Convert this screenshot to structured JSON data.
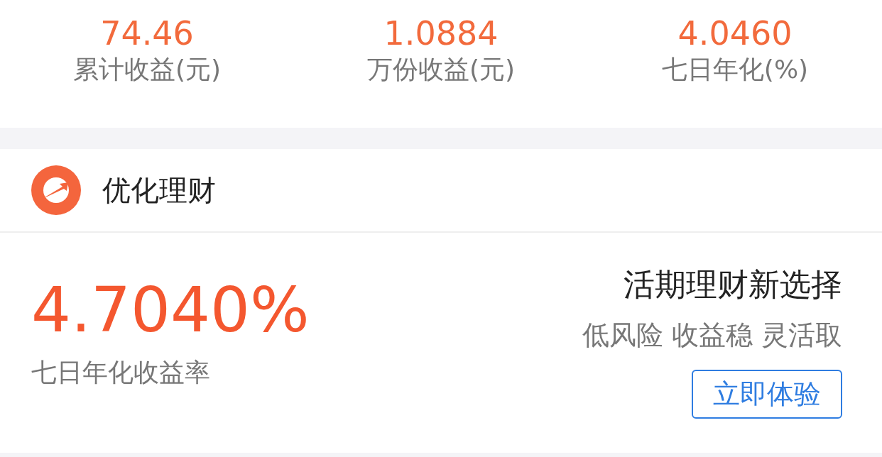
{
  "stats": [
    {
      "value": "74.46",
      "label": "累计收益(元)"
    },
    {
      "value": "1.0884",
      "label": "万份收益(元)"
    },
    {
      "value": "4.0460",
      "label": "七日年化(%)"
    }
  ],
  "section": {
    "title": "优化理财"
  },
  "product": {
    "rate": "4.7040%",
    "rate_label": "七日年化收益率",
    "headline": "活期理财新选择",
    "tags": [
      "低风险",
      "收益稳",
      "灵活取"
    ],
    "button": "立即体验"
  }
}
